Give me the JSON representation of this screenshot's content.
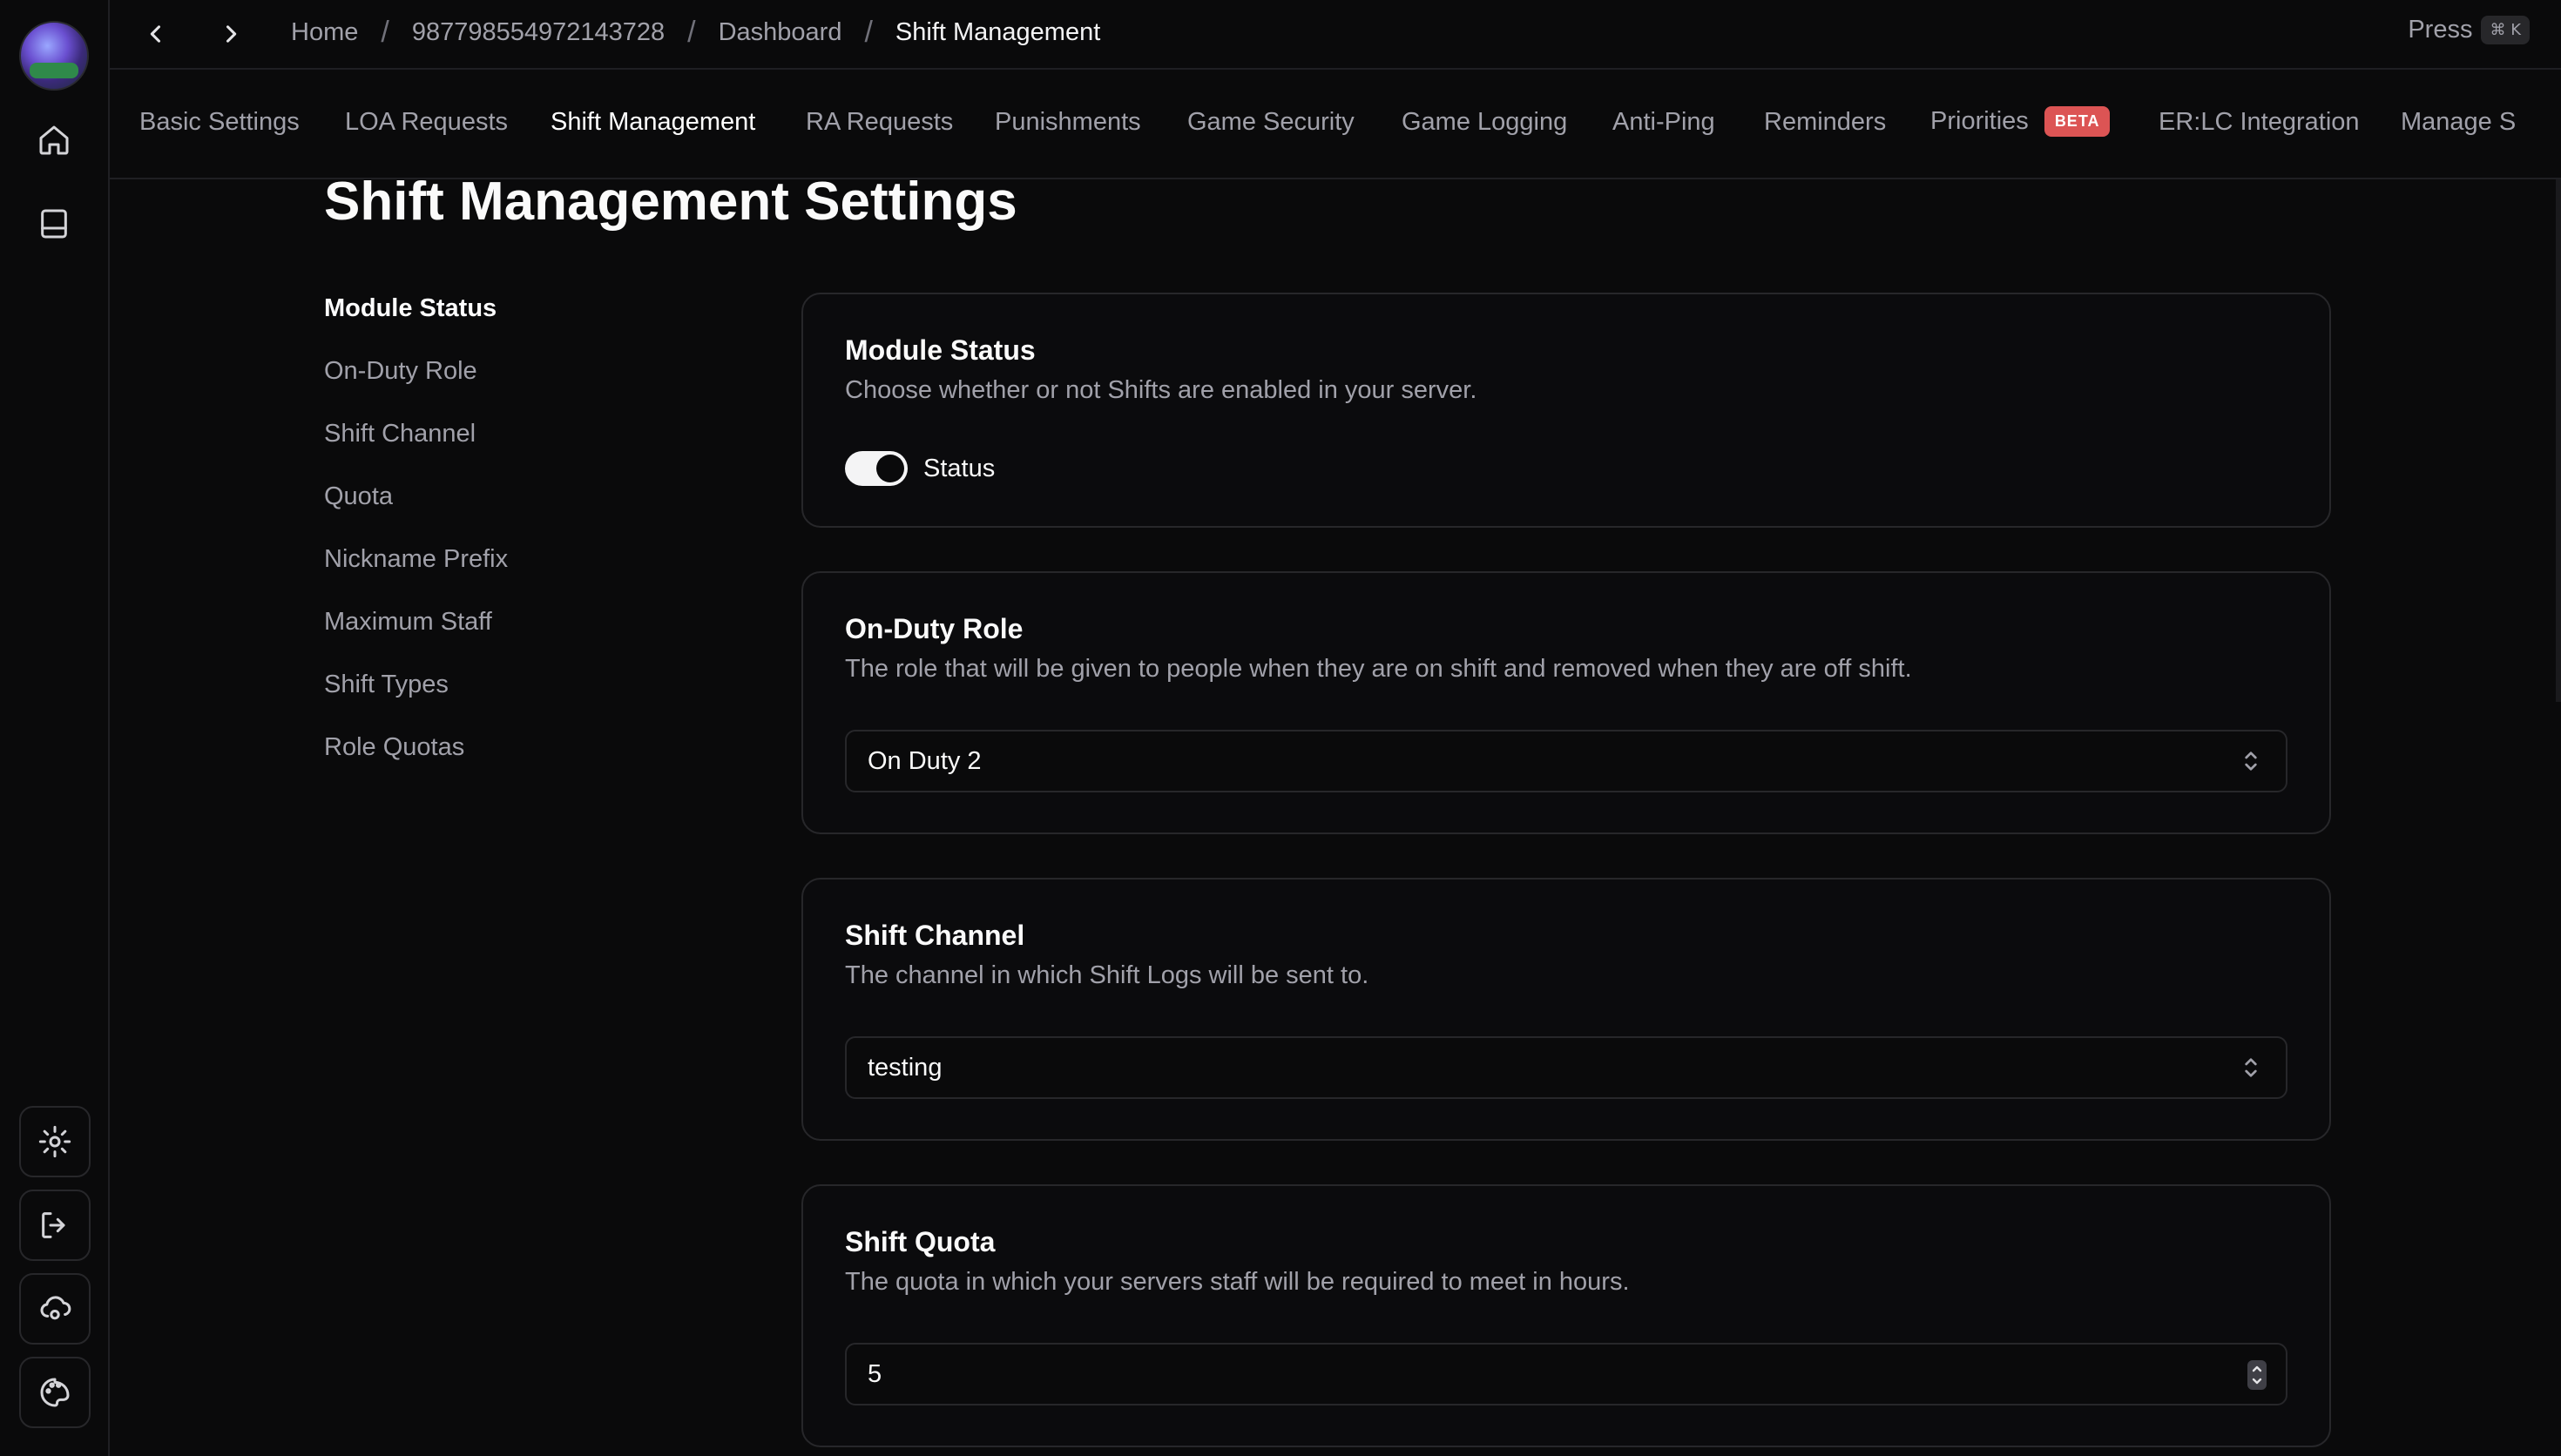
{
  "topbar": {
    "breadcrumbs": [
      "Home",
      "987798554972143728",
      "Dashboard",
      "Shift Management"
    ],
    "separator": "/",
    "press_label": "Press",
    "shortcut": "⌘ K"
  },
  "tabs": [
    {
      "label": "Basic Settings"
    },
    {
      "label": "LOA Requests"
    },
    {
      "label": "Shift Management",
      "active": true
    },
    {
      "label": "RA Requests"
    },
    {
      "label": "Punishments"
    },
    {
      "label": "Game Security"
    },
    {
      "label": "Game Logging"
    },
    {
      "label": "Anti-Ping"
    },
    {
      "label": "Reminders"
    },
    {
      "label": "Priorities",
      "badge": "BETA"
    },
    {
      "label": "ER:LC Integration"
    },
    {
      "label": "Manage S"
    }
  ],
  "page": {
    "title": "Shift Management Settings"
  },
  "side_nav": [
    {
      "label": "Module Status",
      "active": true
    },
    {
      "label": "On-Duty Role"
    },
    {
      "label": "Shift Channel"
    },
    {
      "label": "Quota"
    },
    {
      "label": "Nickname Prefix"
    },
    {
      "label": "Maximum Staff"
    },
    {
      "label": "Shift Types"
    },
    {
      "label": "Role Quotas"
    }
  ],
  "cards": {
    "module_status": {
      "title": "Module Status",
      "desc": "Choose whether or not Shifts are enabled in your server.",
      "toggle_label": "Status",
      "enabled": true
    },
    "on_duty_role": {
      "title": "On-Duty Role",
      "desc": "The role that will be given to people when they are on shift and removed when they are off shift.",
      "value": "On Duty 2"
    },
    "shift_channel": {
      "title": "Shift Channel",
      "desc": "The channel in which Shift Logs will be sent to.",
      "value": "testing"
    },
    "shift_quota": {
      "title": "Shift Quota",
      "desc": "The quota in which your servers staff will be required to meet in hours.",
      "value": "5"
    }
  },
  "colors": {
    "background": "#0a0a0b",
    "border": "#27272a",
    "muted_text": "#a1a1aa",
    "beta_badge": "#dc5454"
  }
}
